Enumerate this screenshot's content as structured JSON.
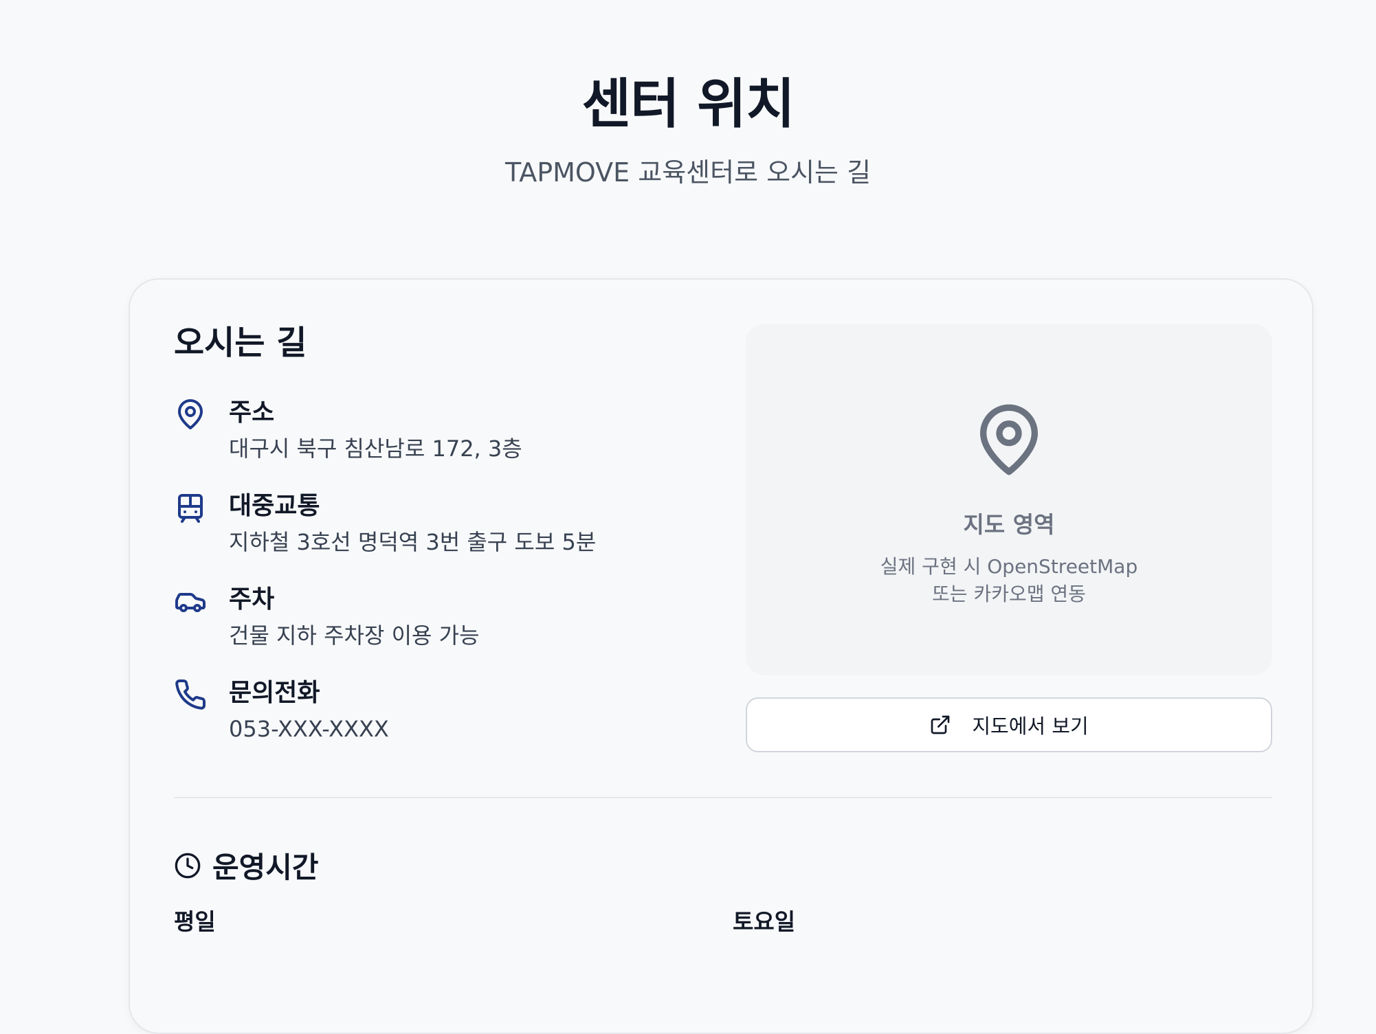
{
  "page": {
    "title": "센터 위치",
    "subtitle": "TAPMOVE 교육센터로 오시는 길"
  },
  "directions": {
    "title": "오시는 길",
    "items": [
      {
        "icon": "map-pin-icon",
        "label": "주소",
        "value": "대구시 북구 침산남로 172, 3층"
      },
      {
        "icon": "train-icon",
        "label": "대중교통",
        "value": "지하철 3호선 명덕역 3번 출구 도보 5분"
      },
      {
        "icon": "car-icon",
        "label": "주차",
        "value": "건물 지하 주차장 이용 가능"
      },
      {
        "icon": "phone-icon",
        "label": "문의전화",
        "value": "053-XXX-XXXX"
      }
    ]
  },
  "map": {
    "title": "지도 영역",
    "desc_line1": "실제 구현 시 OpenStreetMap",
    "desc_line2": "또는 카카오맵 연동",
    "button_label": "지도에서 보기",
    "button_icon": "external-link-icon"
  },
  "hours": {
    "title": "운영시간",
    "icon": "clock-icon",
    "weekday_label": "평일",
    "saturday_label": "토요일"
  },
  "colors": {
    "accent": "#1e3a8a",
    "background": "#f8f9fa",
    "muted": "#6b7280"
  }
}
